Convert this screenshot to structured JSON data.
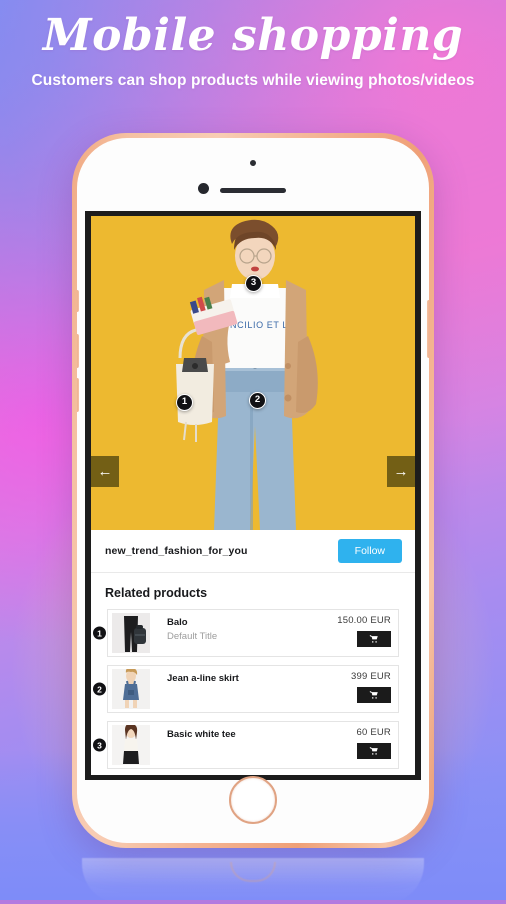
{
  "header": {
    "title": "Mobile shopping",
    "subtitle": "Customers can shop products while viewing photos/videos"
  },
  "colors": {
    "follow_button": "#2fb2ee",
    "cart_button": "#1b1b1b",
    "hotspot": "#111114",
    "photo_background": "#eeb932",
    "nav_arrow": "#584c10",
    "phone_bezel": "#f3b794"
  },
  "phone": {
    "speaker": "speaker-grille",
    "camera": "front-camera",
    "sensor": "proximity-sensor",
    "home_button": "home-button"
  },
  "screen": {
    "photo": {
      "alt": "woman-in-tan-cardigan-on-yellow-background",
      "tee_text": "CONCILIO ET LA",
      "hotspots": [
        {
          "number": "1",
          "target": "Balo"
        },
        {
          "number": "2",
          "target": "Jean a-line skirt"
        },
        {
          "number": "3",
          "target": "Basic white tee"
        }
      ],
      "nav": {
        "prev_icon": "arrow-left-icon",
        "prev_glyph": "←",
        "next_icon": "arrow-right-icon",
        "next_glyph": "→"
      }
    },
    "account": {
      "username": "new_trend_fashion_for_you",
      "follow_label": "Follow"
    },
    "related": {
      "heading": "Related products",
      "cart_icon": "shopping-cart-icon",
      "products": [
        {
          "badge": "1",
          "name": "Balo",
          "variant": "Default Title",
          "price": "150.00 EUR",
          "thumb": "black-pants-and-backpack"
        },
        {
          "badge": "2",
          "name": "Jean a-line skirt",
          "variant": "",
          "price": "399 EUR",
          "thumb": "denim-overall-dress"
        },
        {
          "badge": "3",
          "name": "Basic white tee",
          "variant": "",
          "price": "60 EUR",
          "thumb": "white-top-black-skirt"
        }
      ]
    }
  }
}
